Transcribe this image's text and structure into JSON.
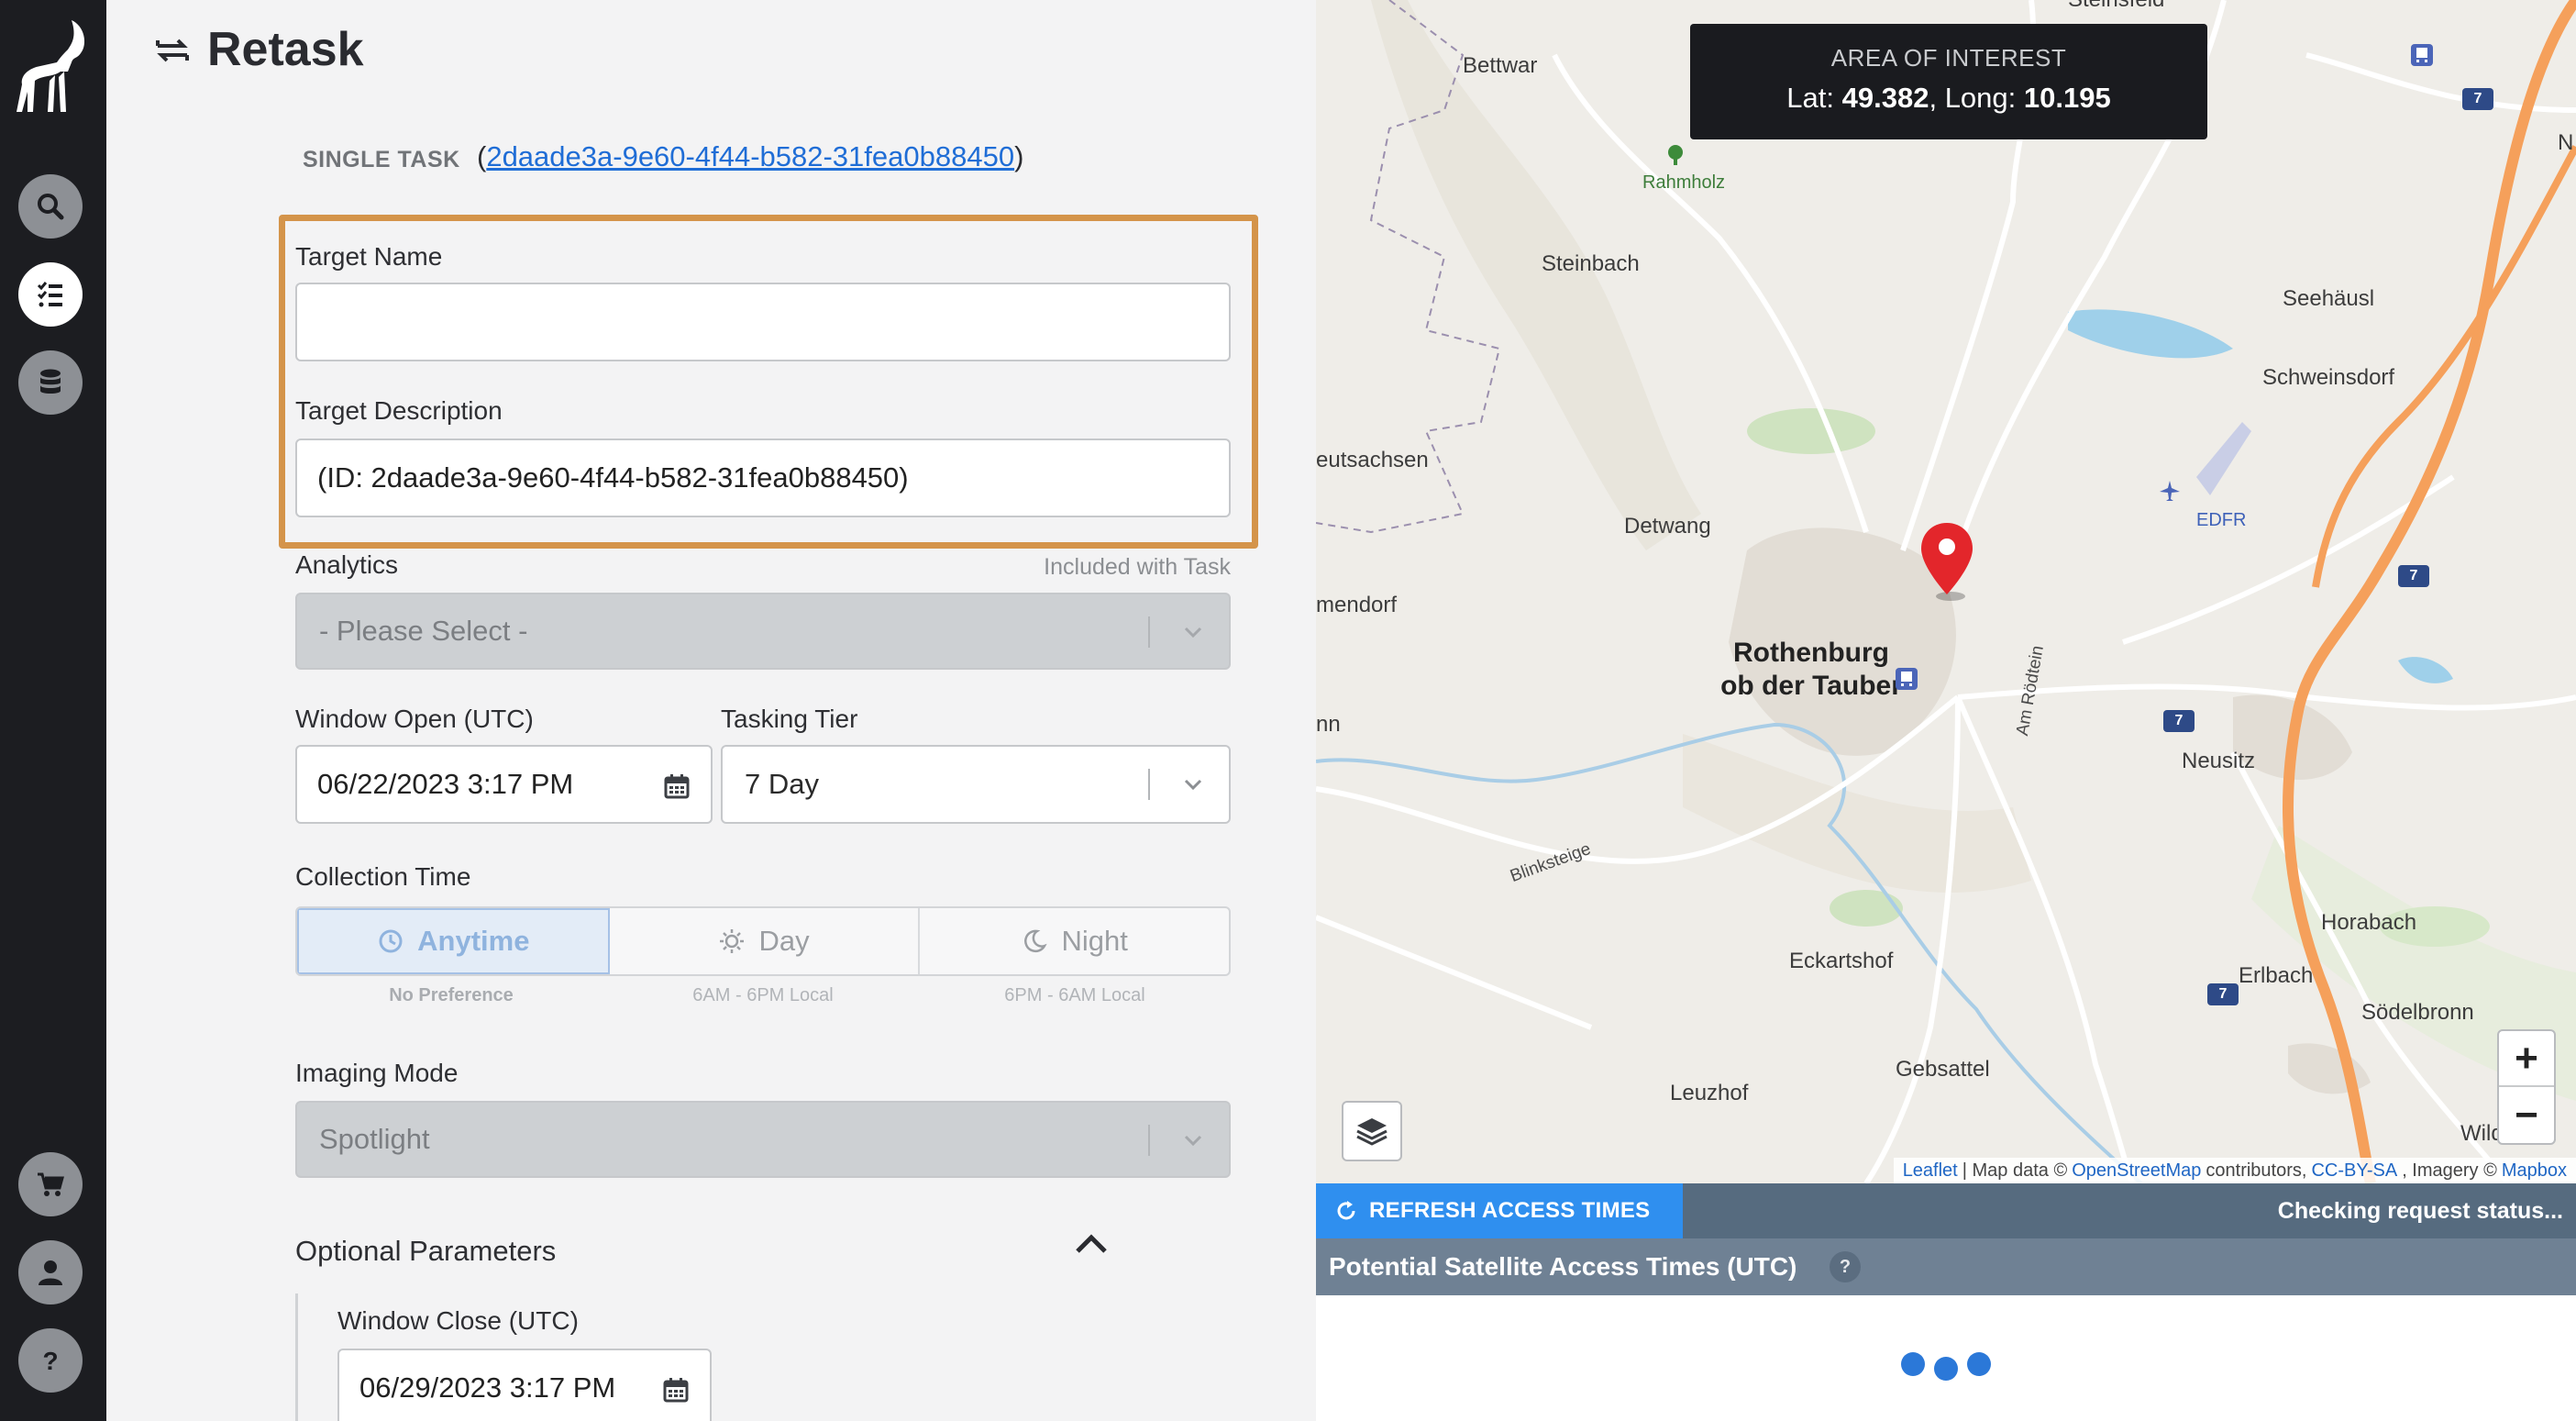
{
  "page": {
    "title": "Retask"
  },
  "task": {
    "type_label": "SINGLE TASK",
    "id": "2daade3a-9e60-4f44-b582-31fea0b88450",
    "paren_open": "(",
    "paren_close": ")"
  },
  "nav": {
    "logo": "ibex-logo",
    "items": [
      "search-icon",
      "task-list-icon",
      "database-icon",
      "cart-icon",
      "account-icon",
      "help-icon"
    ],
    "active": "task-list-icon"
  },
  "form": {
    "target_name": {
      "label": "Target Name",
      "value": ""
    },
    "target_description": {
      "label": "Target Description",
      "value": "(ID: 2daade3a-9e60-4f44-b582-31fea0b88450)"
    },
    "analytics": {
      "label": "Analytics",
      "note": "Included with Task",
      "value": "- Please Select -"
    },
    "window_open": {
      "label": "Window Open (UTC)",
      "value": "06/22/2023 3:17 PM"
    },
    "tasking_tier": {
      "label": "Tasking Tier",
      "value": "7 Day"
    },
    "collection_time": {
      "label": "Collection Time",
      "options": [
        {
          "label": "Anytime",
          "sub": "No Preference",
          "icon": "clock-icon",
          "selected": true
        },
        {
          "label": "Day",
          "sub": "6AM - 6PM Local",
          "icon": "sun-icon",
          "selected": false
        },
        {
          "label": "Night",
          "sub": "6PM - 6AM Local",
          "icon": "moon-icon",
          "selected": false
        }
      ]
    },
    "imaging_mode": {
      "label": "Imaging Mode",
      "value": "Spotlight"
    },
    "optional_parameters": {
      "label": "Optional Parameters",
      "expanded": true
    },
    "window_close": {
      "label": "Window Close (UTC)",
      "value": "06/29/2023 3:17 PM"
    },
    "highlight_color": "#d4944a"
  },
  "map": {
    "aoi": {
      "title": "AREA OF INTEREST",
      "lat_label": "Lat:",
      "lat": "49.382",
      "long_label": "Long:",
      "long": "10.195"
    },
    "places": {
      "bettwar": "Bettwar",
      "rahmholz": "Rahmholz",
      "steinbach": "Steinbach",
      "seehausl": "Seehäusl",
      "schweinsdorf": "Schweinsdorf",
      "eutsachsen": "eutsachsen",
      "detwang": "Detwang",
      "edfr": "EDFR",
      "mendorf": "mendorf",
      "rothenburg1": "Rothenburg",
      "rothenburg2": "ob der Tauber",
      "nn": "nn",
      "am_rodtein": "Am Rödtein",
      "neusitz": "Neusitz",
      "blinksteige": "Blinksteige",
      "horabach": "Horabach",
      "eckartshof": "Eckartshof",
      "erlbach": "Erlbach",
      "sodelbronn": "Södelbronn",
      "gebsattel": "Gebsattel",
      "leuzhof": "Leuzhof",
      "wildenholz": "Wildenhol",
      "n_edge": "N",
      "steinsfeld": "Steinsfeld"
    },
    "road_shield": "7",
    "zoom_in": "+",
    "zoom_out": "−",
    "attribution": {
      "leaflet": "Leaflet",
      "sep1": "| Map data ©",
      "osm": "OpenStreetMap",
      "contrib": "contributors,",
      "ccbysa": "CC-BY-SA",
      "imagery": ", Imagery ©",
      "mapbox": "Mapbox"
    },
    "pin_color": "#e3262b",
    "motorway_color": "#f5a05b"
  },
  "access": {
    "refresh_label": "REFRESH ACCESS TIMES",
    "status": "Checking request status...",
    "title": "Potential Satellite Access Times (UTC)",
    "help": "?",
    "loading": true,
    "accent": "#2f8fef"
  }
}
